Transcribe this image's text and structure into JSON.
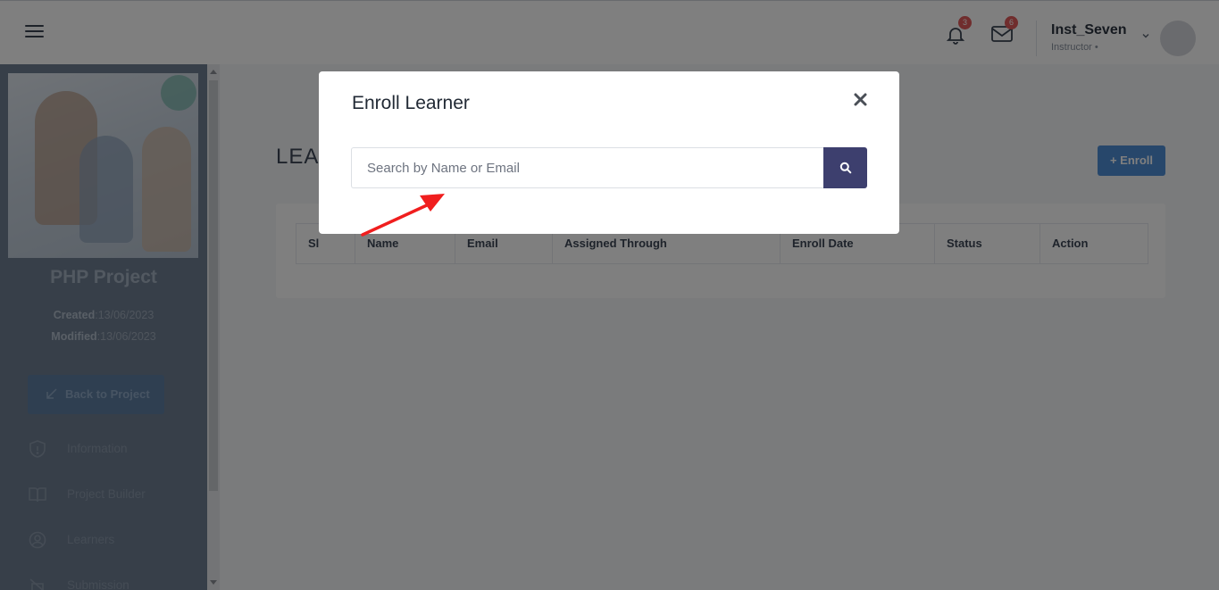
{
  "topbar": {
    "notification_count": "3",
    "message_count": "6",
    "user_name": "Inst_Seven",
    "user_role": "Instructor •"
  },
  "sidebar": {
    "course_title": "PHP Project",
    "created_label": "Created",
    "created_value": ":13/06/2023",
    "modified_label": "Modified",
    "modified_value": ":13/06/2023",
    "back_button": "Back to Project",
    "nav": [
      {
        "label": "Information",
        "icon": "shield-icon"
      },
      {
        "label": "Project Builder",
        "icon": "book-icon"
      },
      {
        "label": "Learners",
        "icon": "user-circle-icon"
      },
      {
        "label": "Submission",
        "icon": "submission-icon"
      }
    ]
  },
  "main": {
    "heading": "LEA",
    "enroll_button": "+ Enroll",
    "table": {
      "columns": [
        "Sl",
        "Name",
        "Email",
        "Assigned Through",
        "Enroll Date",
        "Status",
        "Action"
      ]
    }
  },
  "modal": {
    "title": "Enroll Learner",
    "close_symbol": "×",
    "search_placeholder": "Search by Name or Email",
    "search_value": ""
  },
  "colors": {
    "primary_button": "#3d3f6e",
    "enroll_button": "#4e8fd6",
    "annotation_arrow": "#f01e1e",
    "badge": "#e05a5a"
  }
}
